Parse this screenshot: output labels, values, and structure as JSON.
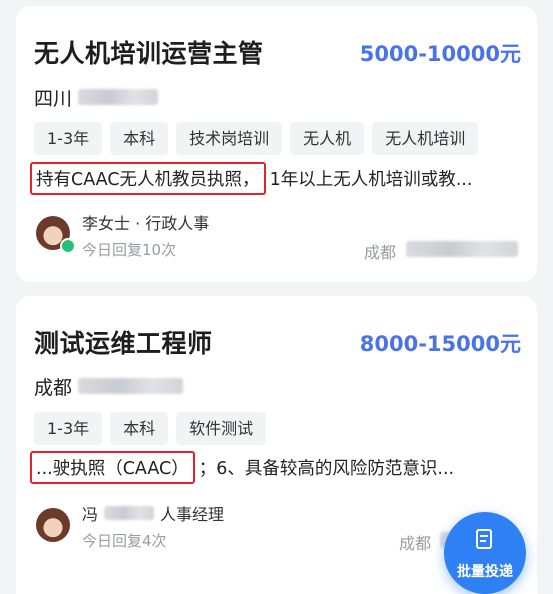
{
  "jobs": [
    {
      "title": "无人机培训运营主管",
      "salary": "5000-10000元",
      "location": "四川",
      "tags": [
        "1-3年",
        "本科",
        "技术岗培训",
        "无人机",
        "无人机培训"
      ],
      "desc_highlight": "持有CAAC无人机教员执照，",
      "desc_rest": "1年以上无人机培训或教...",
      "recruiter": "李女士 · 行政人事",
      "reply": "今日回复10次",
      "city": "成都"
    },
    {
      "title": "测试运维工程师",
      "salary": "8000-15000元",
      "location": "成都",
      "tags": [
        "1-3年",
        "本科",
        "软件测试"
      ],
      "desc_highlight": "...驶执照（CAAC）",
      "desc_rest": "；6、具备较高的风险防范意识...",
      "recruiter_prefix": "冯",
      "recruiter": "人事经理",
      "reply": "今日回复4次",
      "city": "成都"
    }
  ],
  "fab": {
    "label": "批量投递",
    "icon": "clipboard-icon"
  },
  "colors": {
    "accent": "#4a73e8",
    "highlight_border": "#e0242d",
    "fab": "#2f80f5"
  }
}
